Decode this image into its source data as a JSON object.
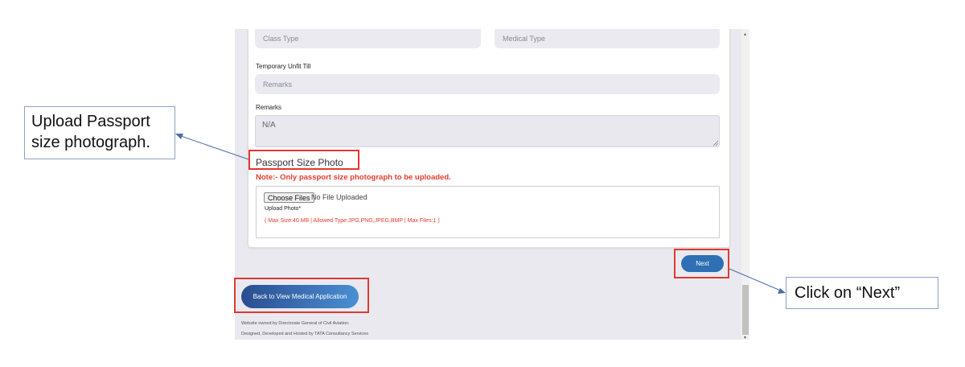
{
  "form": {
    "class_type_placeholder": "Class Type",
    "medical_type_placeholder": "Medical Type",
    "temporary_unfit_label": "Temporary Unfit Till",
    "remarks_field_placeholder": "Remarks",
    "remarks_label": "Remarks",
    "remarks_value": "N/A",
    "passport_title": "Passport Size Photo",
    "note": "Note:- Only passport size photograph to be uploaded.",
    "choose_files": "Choose Files",
    "no_file": "No File Uploaded",
    "upload_label": "Upload Photo*",
    "upload_info": "( Max Size:40 MB | Allowed Type:JPG,PNG,JPEG,BMP | Max Files:1 )"
  },
  "buttons": {
    "next": "Next",
    "back": "Back to View Medical Application"
  },
  "footer": {
    "line1": "Website owned by Directorate General of Civil Aviation.",
    "line2": "Designed, Developed and Hosted by TATA Consultancy Services"
  },
  "callouts": {
    "upload": "Upload Passport size photograph.",
    "next": "Click on “Next”"
  },
  "colors": {
    "accent": "#2f6fb3",
    "highlight": "#e03a30",
    "note_red": "#e23b2f"
  }
}
